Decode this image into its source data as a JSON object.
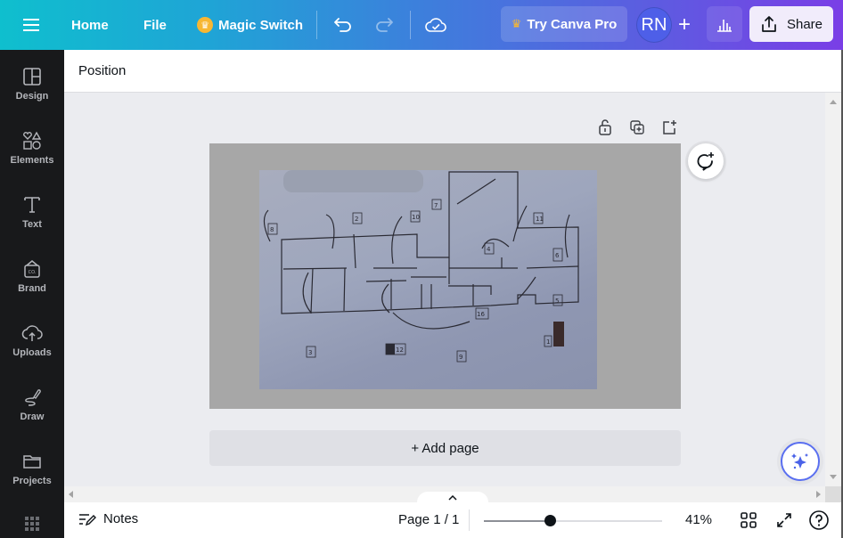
{
  "topbar": {
    "menu_icon": "hamburger-icon",
    "home": "Home",
    "file": "File",
    "magic_switch": "Magic Switch",
    "undo_icon": "undo-icon",
    "redo_icon": "redo-icon",
    "save_status_icon": "cloud-check-icon",
    "try_pro": "Try Canva Pro",
    "avatar_initials": "RN",
    "add_collaborator": "+",
    "insights_icon": "bar-chart-icon",
    "share": "Share"
  },
  "sidebar": {
    "items": [
      {
        "label": "Design",
        "icon": "layout-icon"
      },
      {
        "label": "Elements",
        "icon": "shapes-icon"
      },
      {
        "label": "Text",
        "icon": "text-icon"
      },
      {
        "label": "Brand",
        "icon": "brand-icon"
      },
      {
        "label": "Uploads",
        "icon": "cloud-upload-icon"
      },
      {
        "label": "Draw",
        "icon": "pen-icon"
      },
      {
        "label": "Projects",
        "icon": "folder-icon"
      }
    ],
    "apps_icon": "apps-grid-icon"
  },
  "context_bar": {
    "position_label": "Position"
  },
  "canvas": {
    "page_tools": [
      "lock-icon",
      "duplicate-icon",
      "add-page-icon"
    ],
    "image_description": "Photo of hand-drawn floor plan with numbered markers",
    "markers": [
      "8",
      "2",
      "10",
      "7",
      "11",
      "4",
      "6",
      "3",
      "5",
      "16",
      "1",
      "9",
      "12"
    ],
    "comment_icon": "add-comment-icon",
    "add_page_label": "+ Add page",
    "magic_icon": "sparkle-icon"
  },
  "bottombar": {
    "notes_label": "Notes",
    "page_indicator": "Page 1 / 1",
    "zoom_percent": 41,
    "zoom_label": "41%",
    "zoom_slider_fraction": 0.37,
    "grid_view_icon": "grid-view-icon",
    "fullscreen_icon": "expand-icon",
    "help_icon": "help-icon"
  },
  "colors": {
    "topbar_gradient_start": "#0fbfce",
    "topbar_gradient_end": "#7a3ee6",
    "sidebar_bg": "#18191b",
    "canvas_bg": "#ebecf0",
    "avatar_bg": "#4e5fe8",
    "crown": "#f7b733"
  }
}
